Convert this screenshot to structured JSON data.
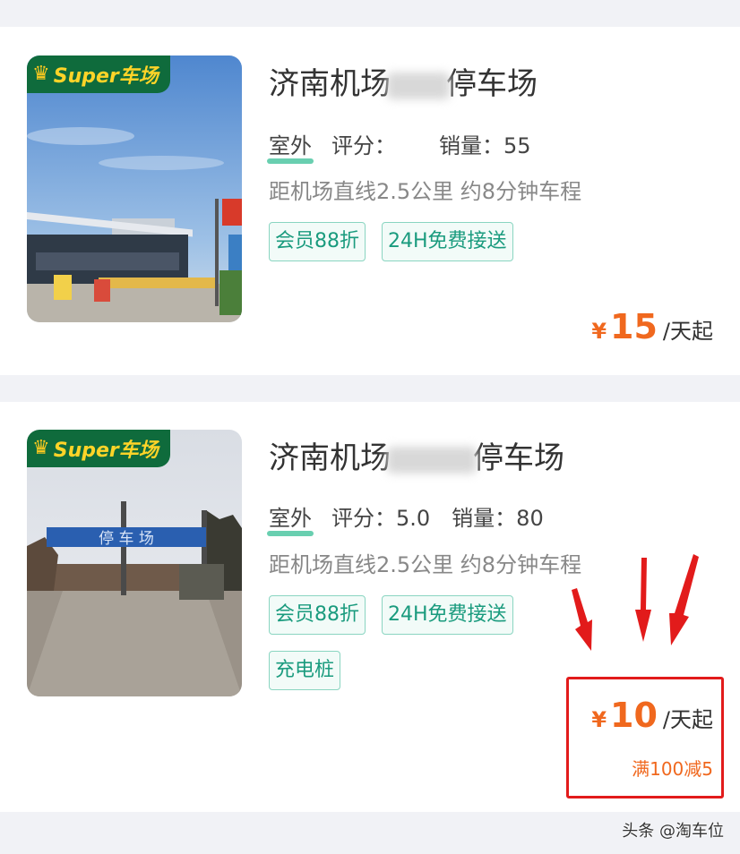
{
  "listings": [
    {
      "badge": "Super车场",
      "title_start": "济南机场",
      "title_end": "停车场",
      "kind": "室外",
      "rating_label": "评分：",
      "rating": "",
      "sales_label": "销量：",
      "sales": "55",
      "distance": "距机场直线2.5公里 约8分钟车程",
      "tags": [
        "会员88折",
        "24H免费接送"
      ],
      "currency": "¥",
      "price": "15",
      "unit": "/天起"
    },
    {
      "badge": "Super车场",
      "title_start": "济南机场",
      "title_end": "停车场",
      "kind": "室外",
      "rating_label": "评分：",
      "rating": "5.0",
      "sales_label": "销量：",
      "sales": "80",
      "distance": "距机场直线2.5公里 约8分钟车程",
      "tags": [
        "会员88折",
        "24H免费接送",
        "充电桩"
      ],
      "currency": "¥",
      "price": "10",
      "unit": "/天起",
      "promo": "满100减5",
      "sign_text": "停 车 场"
    }
  ],
  "watermark": "头条 @淘车位",
  "colors": {
    "accent": "#f0681e",
    "tag": "#1a9b7e",
    "badge_bg": "#0f6b3c",
    "highlight": "#e21b1b"
  }
}
